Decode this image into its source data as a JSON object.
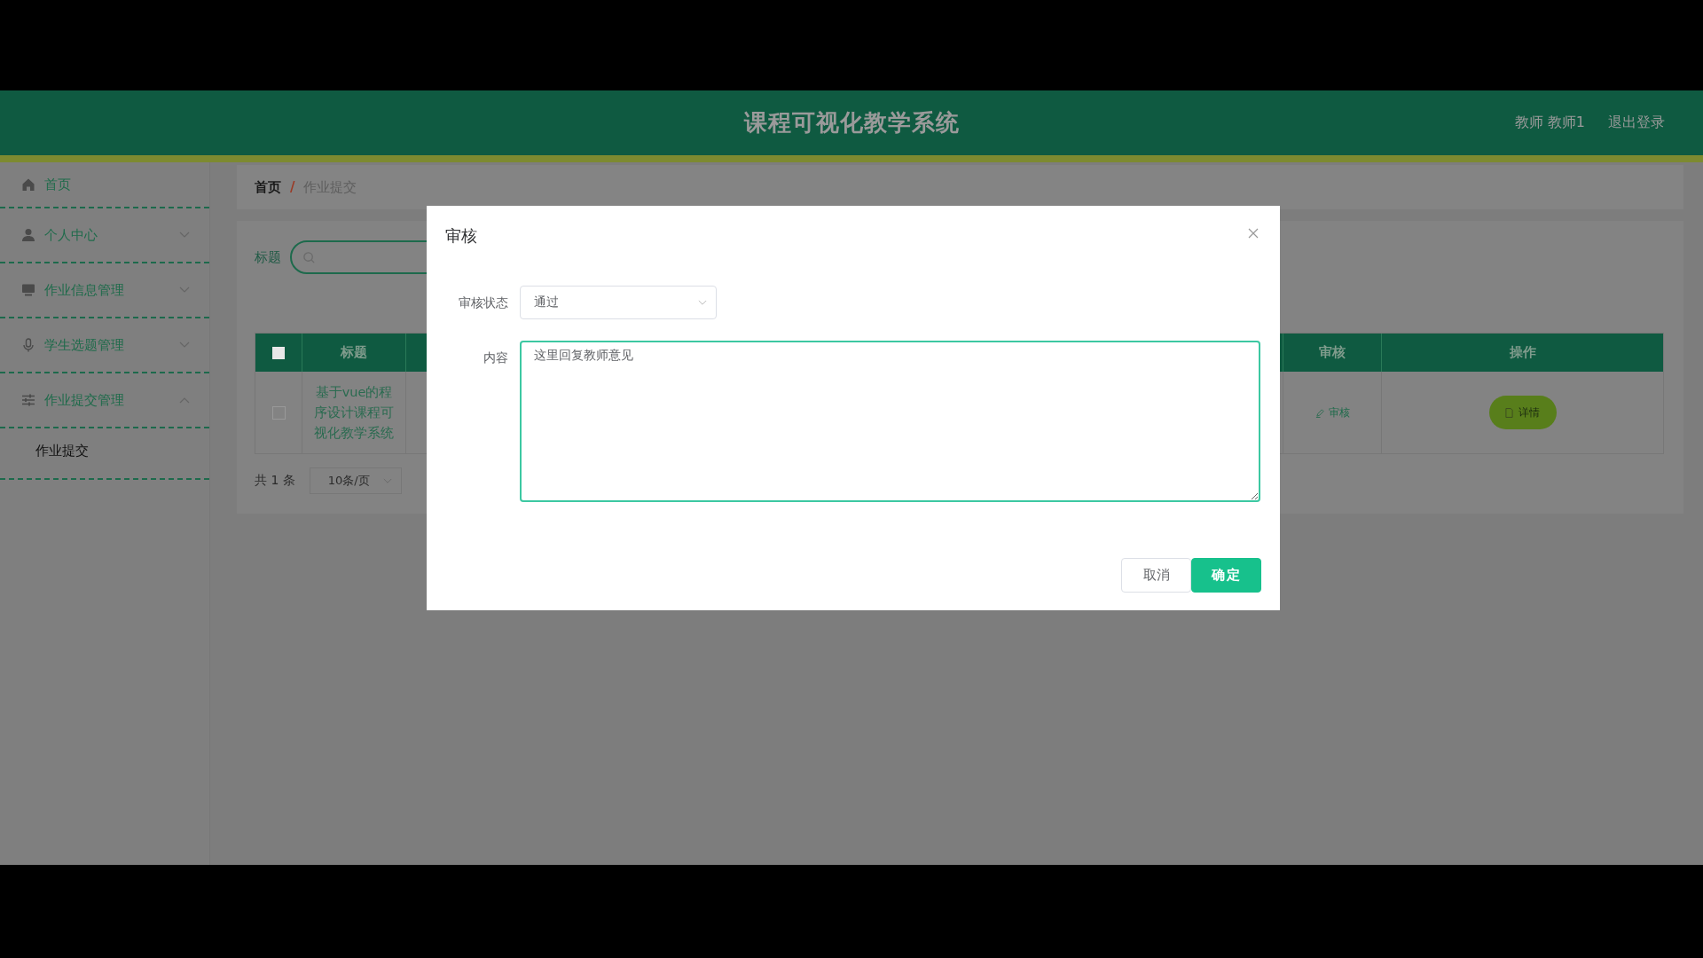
{
  "header": {
    "title": "课程可视化教学系统",
    "user": "教师 教师1",
    "logout": "退出登录"
  },
  "sidebar": {
    "items": [
      {
        "label": "首页",
        "kind": "link"
      },
      {
        "label": "个人中心",
        "kind": "menu",
        "expanded": false
      },
      {
        "label": "作业信息管理",
        "kind": "menu",
        "expanded": false
      },
      {
        "label": "学生选题管理",
        "kind": "menu",
        "expanded": false
      },
      {
        "label": "作业提交管理",
        "kind": "menu",
        "expanded": true,
        "children": [
          {
            "label": "作业提交"
          }
        ]
      }
    ]
  },
  "breadcrumb": [
    "首页",
    "作业提交"
  ],
  "breadcrumb_separator": "/",
  "search": {
    "label": "标题"
  },
  "table": {
    "select_all": {
      "checked": false
    },
    "columns": [
      {
        "label": "标题"
      },
      {
        "label": "审核"
      },
      {
        "label": "操作"
      }
    ],
    "rows": [
      {
        "title": "基于vue的程序设计课程可视化教学系统",
        "checked": false,
        "review": "审核",
        "action": "详情"
      }
    ]
  },
  "pagination": {
    "total": "共 1 条",
    "page_size": "10条/页"
  },
  "dialog": {
    "title": "审核",
    "fields": [
      {
        "label": "审核状态",
        "kind": "select",
        "value": "通过"
      },
      {
        "label": "内容",
        "kind": "textarea",
        "value": "这里回复教师意见"
      }
    ],
    "buttons": [
      {
        "label": "取消",
        "kind": "default"
      },
      {
        "label": "确定",
        "kind": "primary"
      }
    ]
  }
}
